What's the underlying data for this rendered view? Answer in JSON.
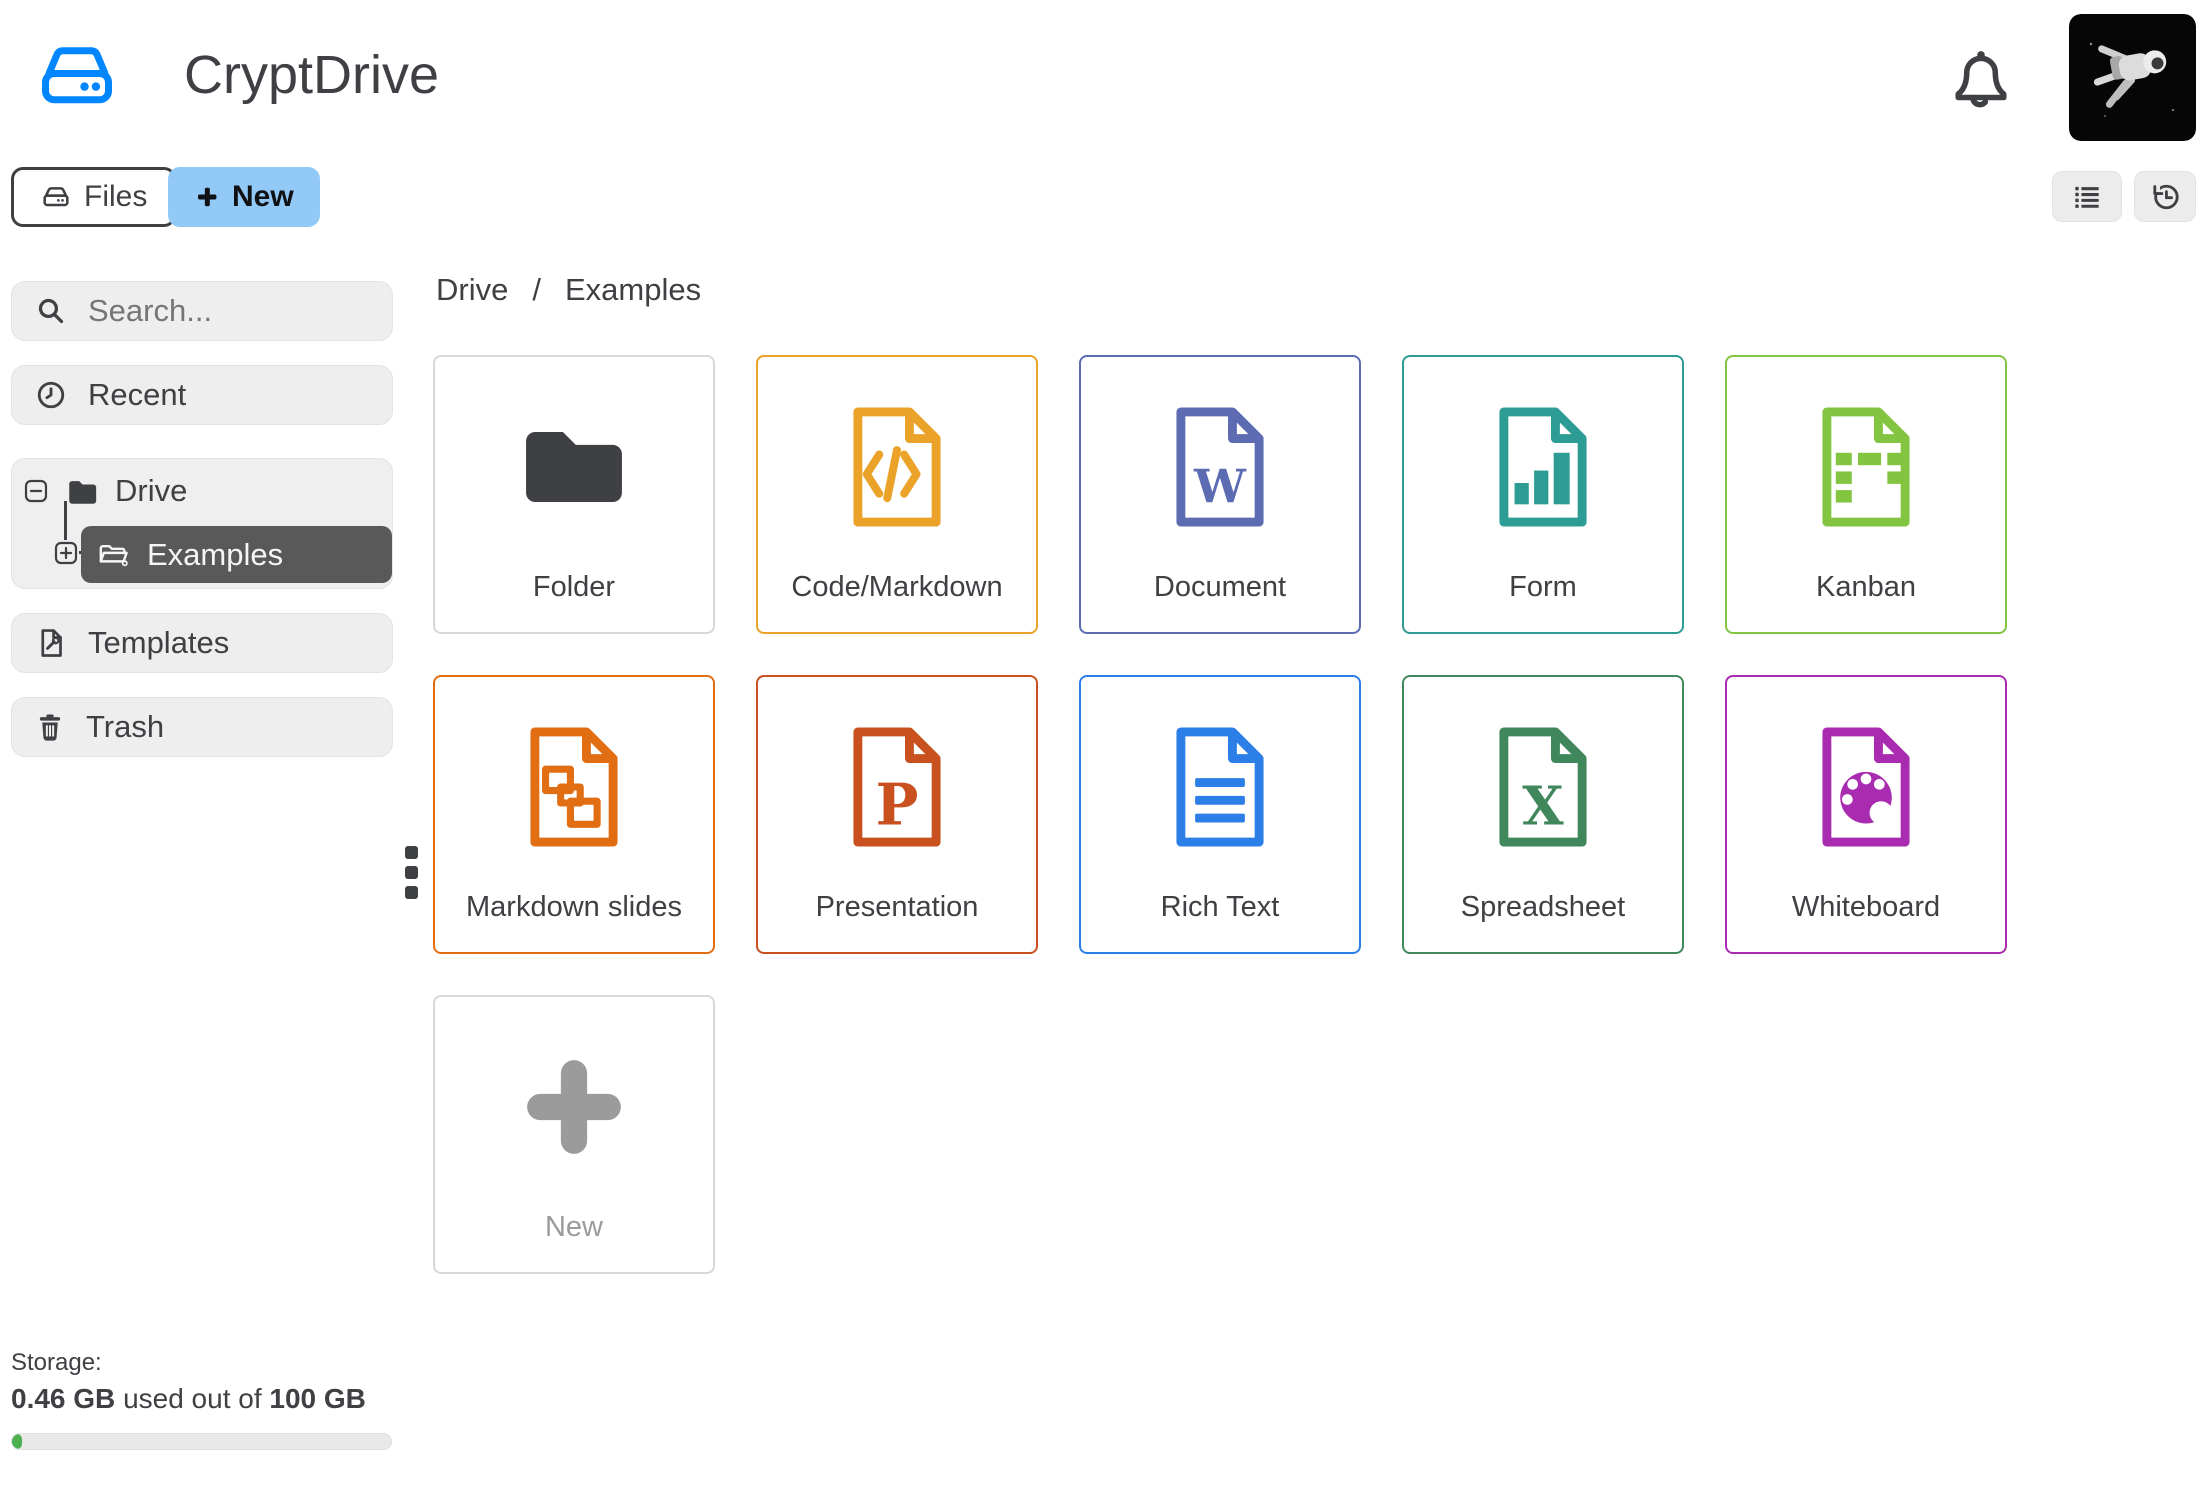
{
  "header": {
    "app_title": "CryptDrive",
    "bell_icon": "bell-icon",
    "avatar": "user-avatar"
  },
  "toolbar": {
    "files_label": "Files",
    "files_icon": "drive-icon",
    "new_label": "New",
    "new_icon": "plus-icon",
    "list_view_icon": "list-icon",
    "history_icon": "history-icon"
  },
  "sidebar": {
    "search_placeholder": "Search...",
    "search_icon": "search-icon",
    "recent_label": "Recent",
    "recent_icon": "clock-icon",
    "drive_label": "Drive",
    "drive_icon": "folder-solid-icon",
    "examples_label": "Examples",
    "examples_icon": "folder-open-icon",
    "templates_label": "Templates",
    "templates_icon": "template-file-icon",
    "trash_label": "Trash",
    "trash_icon": "trash-icon"
  },
  "breadcrumb": {
    "root": "Drive",
    "separator": "/",
    "current": "Examples"
  },
  "tiles": [
    {
      "label": "Folder",
      "color": "#3F4044",
      "border": "#D8D8D8",
      "icon": "folder-icon"
    },
    {
      "label": "Code/Markdown",
      "color": "#EAA229",
      "border": "#EAA229",
      "icon": "code-file-icon"
    },
    {
      "label": "Document",
      "color": "#5C6BB2",
      "border": "#5C6BB2",
      "icon": "document-file-icon",
      "letter": "W"
    },
    {
      "label": "Form",
      "color": "#2C9C94",
      "border": "#2C9C94",
      "icon": "form-file-icon"
    },
    {
      "label": "Kanban",
      "color": "#83C441",
      "border": "#83C441",
      "icon": "kanban-file-icon"
    },
    {
      "label": "Markdown slides",
      "color": "#E26E14",
      "border": "#E26E14",
      "icon": "slides-file-icon"
    },
    {
      "label": "Presentation",
      "color": "#C8511F",
      "border": "#C8511F",
      "icon": "presentation-file-icon",
      "letter": "P"
    },
    {
      "label": "Rich Text",
      "color": "#2D7FE8",
      "border": "#2D7FE8",
      "icon": "richtext-file-icon"
    },
    {
      "label": "Spreadsheet",
      "color": "#40875C",
      "border": "#40875C",
      "icon": "spreadsheet-file-icon",
      "letter": "X"
    },
    {
      "label": "Whiteboard",
      "color": "#A92BB0",
      "border": "#A92BB0",
      "icon": "whiteboard-file-icon"
    }
  ],
  "new_tile": {
    "label": "New",
    "color": "#9B9B9B",
    "border": "#D8D8D8",
    "label_color": "#9B9B9B",
    "icon": "plus-icon"
  },
  "storage": {
    "label": "Storage:",
    "used": "0.46 GB",
    "infix": "used out of",
    "total": "100 GB",
    "bar_color": "#4CAF50"
  },
  "colors": {
    "brand_blue": "#0087FF",
    "new_button_bg": "#92C9F7",
    "text": "#3F4044",
    "item_bg": "#EEEEEE",
    "selected_bg": "#595959"
  }
}
